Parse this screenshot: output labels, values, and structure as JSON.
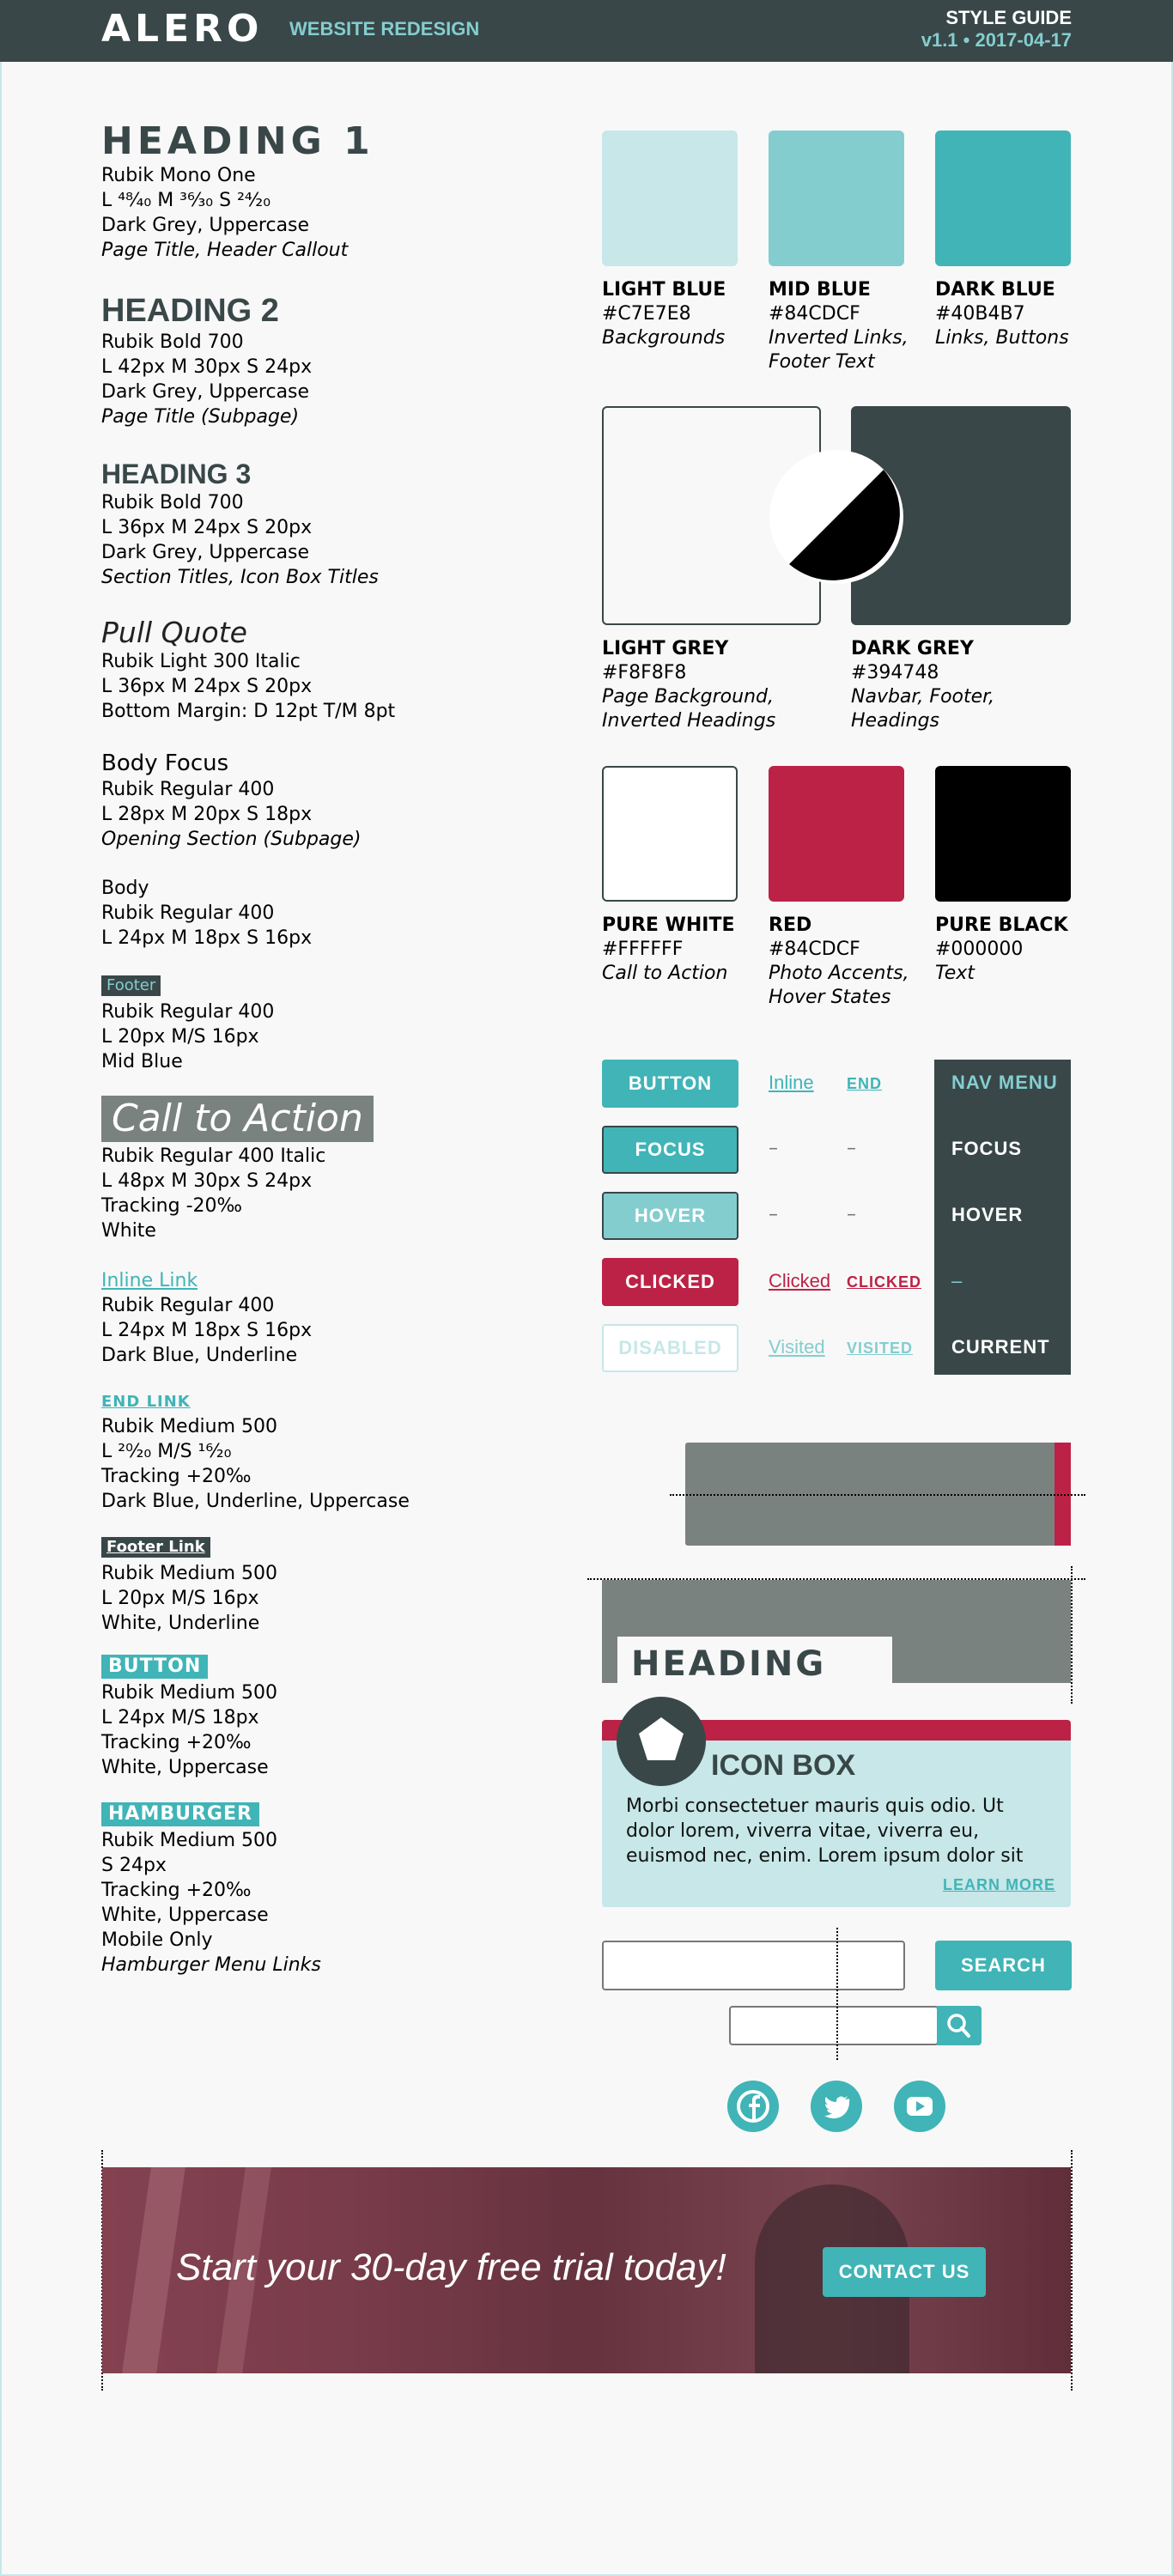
{
  "header": {
    "brand": "ALERO",
    "subtitle": "WEBSITE REDESIGN",
    "doc_title": "STYLE GUIDE",
    "version": "v1.1 • 2017-04-17"
  },
  "typography": {
    "h1": {
      "sample": "HEADING 1",
      "lines": [
        "Rubik Mono One",
        "L ⁴⁸⁄₄₀   M ³⁶⁄₃₀   S ²⁴⁄₂₀",
        "Dark Grey, Uppercase"
      ],
      "use": "Page Title, Header Callout"
    },
    "h2": {
      "sample": "HEADING 2",
      "lines": [
        "Rubik Bold 700",
        "L 42px    M 30px    S 24px",
        "Dark Grey, Uppercase"
      ],
      "use": "Page Title (Subpage)"
    },
    "h3": {
      "sample": "HEADING 3",
      "lines": [
        "Rubik Bold 700",
        "L 36px    M 24px    S 20px",
        "Dark Grey, Uppercase"
      ],
      "use": "Section Titles, Icon Box Titles"
    },
    "pull_quote": {
      "sample": "Pull Quote",
      "lines": [
        "Rubik Light 300 Italic",
        "L 36px    M 24px    S 20px",
        "Bottom Margin:   D 12pt    T/M 8pt"
      ]
    },
    "body_focus": {
      "sample": "Body Focus",
      "lines": [
        "Rubik Regular 400",
        "L 28px    M 20px    S 18px"
      ],
      "use": "Opening Section (Subpage)"
    },
    "body": {
      "sample": "Body",
      "lines": [
        "Rubik Regular 400",
        "L 24px    M 18px    S 16px"
      ]
    },
    "footer": {
      "sample": "Footer",
      "lines": [
        "Rubik Regular 400",
        "L 20px    M/S 16px",
        "Mid Blue"
      ]
    },
    "cta": {
      "sample": "Call to Action",
      "lines": [
        "Rubik Regular 400 Italic",
        "L 48px    M 30px    S 24px",
        "Tracking -20‰",
        "White"
      ]
    },
    "inline_link": {
      "sample": "Inline Link",
      "lines": [
        "Rubik Regular 400",
        "L 24px    M 18px    S 16px",
        "Dark Blue, Underline"
      ]
    },
    "end_link": {
      "sample": "END LINK",
      "lines": [
        "Rubik Medium 500",
        "L ²⁰⁄₂₀    M/S ¹⁶⁄₂₀",
        "Tracking +20‰",
        "Dark Blue, Underline, Uppercase"
      ]
    },
    "footer_link": {
      "sample": "Footer Link",
      "lines": [
        "Rubik Medium 500",
        "L 20px    M/S 16px",
        "White, Underline"
      ]
    },
    "button": {
      "sample": "BUTTON",
      "lines": [
        "Rubik Medium 500",
        "L 24px    M/S 18px",
        "Tracking +20‰",
        "White, Uppercase"
      ]
    },
    "hamburger": {
      "sample": "HAMBURGER",
      "lines": [
        "Rubik Medium 500",
        "S 24px",
        "Tracking +20‰",
        "White, Uppercase",
        "Mobile Only"
      ],
      "use": "Hamburger Menu Links"
    }
  },
  "colors": [
    {
      "name": "LIGHT BLUE",
      "hex": "#C7E7E8",
      "swatch": "#C7E7E8",
      "use1": "Backgrounds",
      "use2": ""
    },
    {
      "name": "MID BLUE",
      "hex": "#84CDCF",
      "swatch": "#84CDCF",
      "use1": "Inverted Links,",
      "use2": "Footer Text"
    },
    {
      "name": "DARK BLUE",
      "hex": "#40B4B7",
      "swatch": "#40B4B7",
      "use1": "Links, Buttons",
      "use2": ""
    },
    {
      "name": "LIGHT GREY",
      "hex": "#F8F8F8",
      "swatch": "#F8F8F8",
      "use1": "Page Background,",
      "use2": "Inverted Headings"
    },
    {
      "name": "DARK GREY",
      "hex": "#394748",
      "swatch": "#394748",
      "use1": "Navbar, Footer,",
      "use2": "Headings"
    },
    {
      "name": "PURE WHITE",
      "hex": "#FFFFFF",
      "swatch": "#FFFFFF",
      "use1": "Call to Action",
      "use2": ""
    },
    {
      "name": "RED",
      "hex": "#84CDCF",
      "swatch": "#BC2246",
      "use1": "Photo Accents,",
      "use2": "Hover States"
    },
    {
      "name": "PURE BLACK",
      "hex": "#000000",
      "swatch": "#000000",
      "use1": "Text",
      "use2": ""
    }
  ],
  "states": {
    "buttons": [
      "BUTTON",
      "FOCUS",
      "HOVER",
      "CLICKED",
      "DISABLED"
    ],
    "inline": {
      "default": "Inline",
      "clicked": "Clicked",
      "visited": "Visited"
    },
    "end": {
      "default": "END",
      "clicked": "CLICKED",
      "visited": "VISITED"
    },
    "dash": "–",
    "nav": {
      "title": "NAV MENU",
      "focus": "FOCUS",
      "hover": "HOVER",
      "clicked": "–",
      "current": "CURRENT"
    }
  },
  "components": {
    "heading_demo": "HEADING",
    "icon_box": {
      "title": "ICON BOX",
      "body": [
        "Morbi consectetuer mauris quis odio. Ut",
        "dolor lorem, viverra vitae, viverra eu,",
        "euismod nec, enim. Lorem ipsum dolor sit"
      ],
      "link": "LEARN MORE"
    },
    "search": {
      "button": "SEARCH",
      "placeholder": ""
    },
    "social": [
      "facebook-icon",
      "twitter-icon",
      "youtube-icon"
    ],
    "banner": {
      "text": "Start your 30-day free trial today!",
      "button": "CONTACT US"
    }
  },
  "accent_colors": {
    "dark_grey": "#394748",
    "dark_blue": "#40B4B7",
    "mid_blue": "#84CDCF",
    "light_blue": "#C7E7E8",
    "red": "#BC2246"
  }
}
